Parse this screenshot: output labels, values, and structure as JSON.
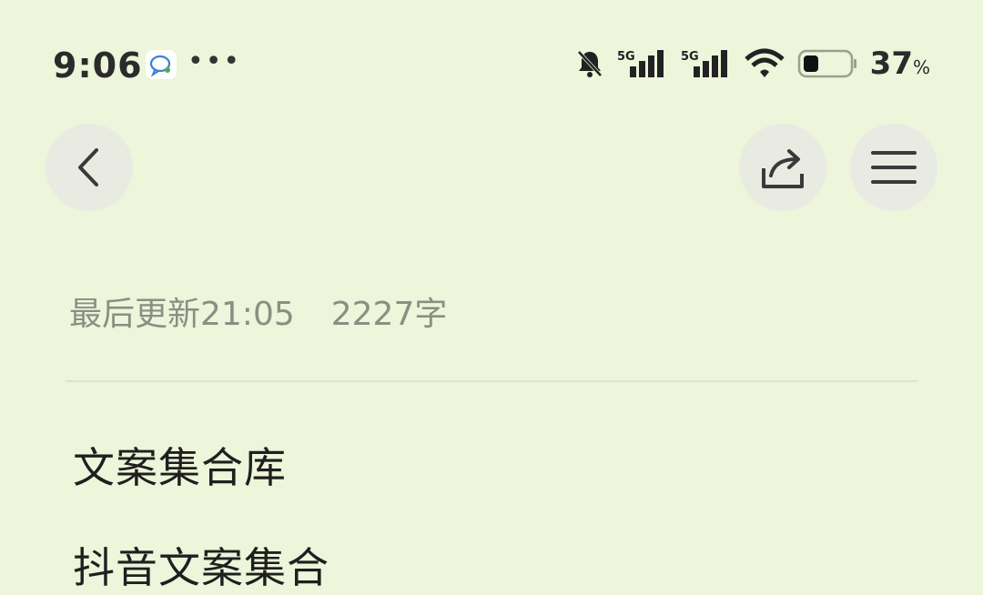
{
  "status_bar": {
    "time": "9:06",
    "more_indicator": "•••",
    "battery_percent": "37",
    "battery_unit": "%",
    "icons": [
      "chat-notification-icon",
      "bell-muted-icon",
      "5g-signal-icon",
      "5g-signal-icon",
      "wifi-icon",
      "battery-icon"
    ]
  },
  "toolbar": {
    "back_icon": "chevron-left-icon",
    "share_icon": "share-icon",
    "menu_icon": "menu-icon"
  },
  "note": {
    "last_updated": "最后更新21:05",
    "word_count": "2227字",
    "title": "文案集合库",
    "next_line": "抖音文案集合"
  }
}
